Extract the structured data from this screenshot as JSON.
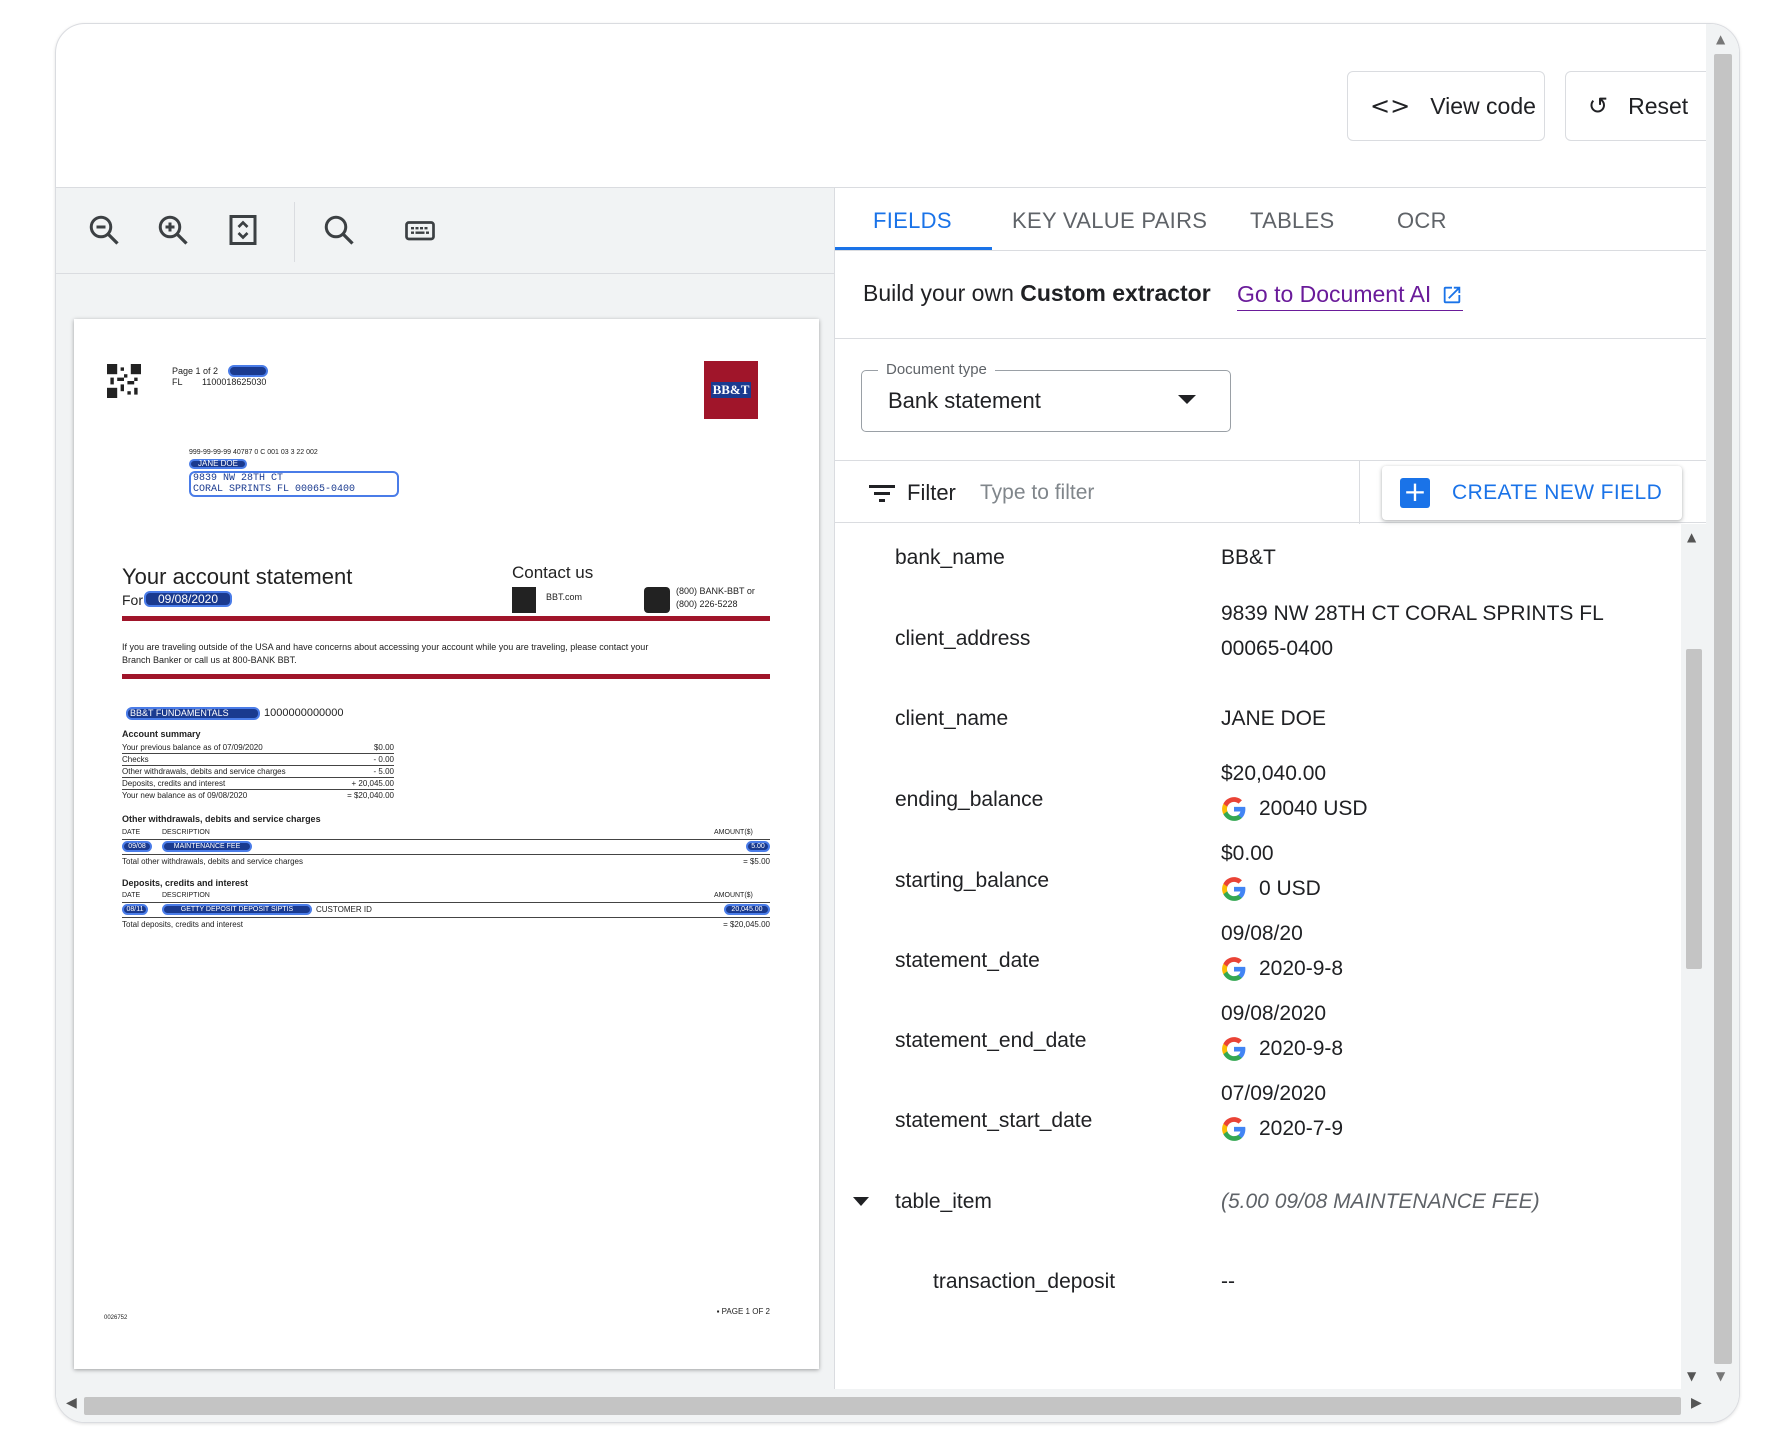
{
  "header": {
    "view_code_label": "View code",
    "reset_label": "Reset"
  },
  "viewer": {
    "tools": [
      "zoom-out-icon",
      "zoom-in-icon",
      "fit-page-icon",
      "search-icon",
      "keyboard-icon"
    ],
    "doc": {
      "page_label": "Page 1 of 2",
      "state": "FL",
      "id_number": "1100018625030",
      "bank_logo": "BB&T",
      "routing_line": "999-99-99-99 40787 0 C 001 03 3 22 002",
      "addr_name": "JANE DOE",
      "addr_line1": "9839 NW 28TH CT",
      "addr_line2": "CORAL SPRINTS FL 00065-0400",
      "title": "Your account statement",
      "for_label": "For",
      "for_date": "09/08/2020",
      "contact_title": "Contact us",
      "contact_web": "BBT.com",
      "contact_phone1": "(800) BANK-BBT or",
      "contact_phone2": "(800) 226-5228",
      "notice_line1": "If you are traveling outside of the USA and have concerns about accessing your account while you are traveling, please contact your",
      "notice_line2": "Branch Banker or call us at 800-BANK BBT.",
      "account_name": "BB&T FUNDAMENTALS",
      "account_number": "1000000000000",
      "summary_title": "Account summary",
      "summary_rows": [
        {
          "label": "Your previous balance as of 07/09/2020",
          "value": "$0.00"
        },
        {
          "label": "Checks",
          "value": "- 0.00"
        },
        {
          "label": "Other withdrawals, debits and service charges",
          "value": "- 5.00"
        },
        {
          "label": "Deposits, credits and interest",
          "value": "+ 20,045.00"
        },
        {
          "label": "Your new balance as of 09/08/2020",
          "value": "= $20,040.00"
        }
      ],
      "withdrawals_title": "Other withdrawals, debits and service charges",
      "col_date": "DATE",
      "col_desc": "DESCRIPTION",
      "col_amount": "AMOUNT($)",
      "withdrawal_row": {
        "date": "09/08",
        "desc": "MAINTENANCE FEE",
        "amount": "5.00"
      },
      "withdrawals_total_label": "Total other withdrawals, debits and service charges",
      "withdrawals_total": "= $5.00",
      "deposits_title": "Deposits, credits and interest",
      "deposit_row": {
        "date": "08/11",
        "desc": "GETTY DEPOSIT DEPOSIT SIPTIS",
        "suffix": "CUSTOMER ID",
        "amount": "20,045.00"
      },
      "deposits_total_label": "Total deposits, credits and interest",
      "deposits_total": "= $20,045.00",
      "footer_code": "0026752",
      "footer_page": "▪ PAGE 1 OF 2"
    }
  },
  "tabs": [
    "FIELDS",
    "KEY VALUE PAIRS",
    "TABLES",
    "OCR"
  ],
  "promo": {
    "prefix": "Build your own ",
    "bold": "Custom extractor",
    "link": "Go to Document AI"
  },
  "doctype": {
    "label": "Document type",
    "value": "Bank statement"
  },
  "filter": {
    "label": "Filter",
    "placeholder": "Type to filter",
    "create_label": "CREATE NEW FIELD"
  },
  "fields": [
    {
      "name": "bank_name",
      "value": "BB&T"
    },
    {
      "name": "client_address",
      "value": "9839 NW 28TH CT CORAL SPRINTS FL 00065-0400"
    },
    {
      "name": "client_name",
      "value": "JANE DOE"
    },
    {
      "name": "ending_balance",
      "value": "$20,040.00",
      "normalized": "20040 USD"
    },
    {
      "name": "starting_balance",
      "value": "$0.00",
      "normalized": "0 USD"
    },
    {
      "name": "statement_date",
      "value": "09/08/20",
      "normalized": "2020-9-8"
    },
    {
      "name": "statement_end_date",
      "value": "09/08/2020",
      "normalized": "2020-9-8"
    },
    {
      "name": "statement_start_date",
      "value": "07/09/2020",
      "normalized": "2020-7-9"
    },
    {
      "name": "table_item",
      "value": "(5.00 09/08 MAINTENANCE FEE)"
    },
    {
      "name": "transaction_deposit",
      "value": "--"
    }
  ],
  "colors": {
    "accent": "#1a73e8",
    "link": "#6a1b9a",
    "bank_red": "#a0152a",
    "highlight": "#1a3a8f"
  }
}
